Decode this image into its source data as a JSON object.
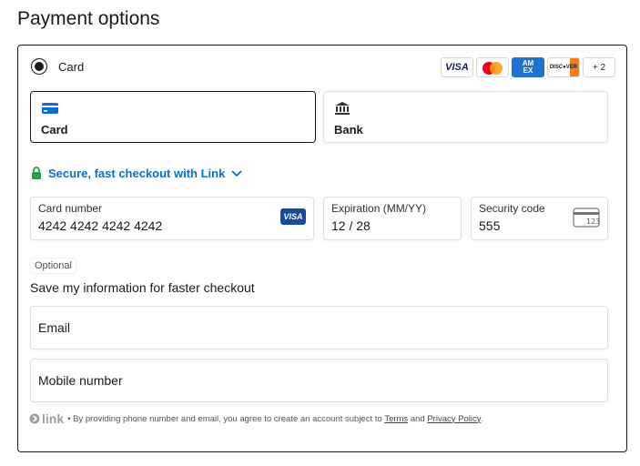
{
  "page": {
    "title": "Payment options"
  },
  "card_option": {
    "label": "Card",
    "brands": {
      "visa": "VISA",
      "amex_top": "AM",
      "amex_bottom": "EX",
      "discover": "DISC●VER",
      "more": "+ 2"
    }
  },
  "methods": [
    {
      "label": "Card",
      "icon": "credit-card-icon",
      "selected": true
    },
    {
      "label": "Bank",
      "icon": "bank-icon",
      "selected": false
    }
  ],
  "link_checkout": {
    "label": "Secure, fast checkout with Link",
    "icon": "lock-icon"
  },
  "card_fields": {
    "number_label": "Card number",
    "number_value": "4242 4242 4242 4242",
    "number_brand": "VISA",
    "expiry_label": "Expiration (MM/YY)",
    "expiry_value": "12 / 28",
    "cvc_label": "Security code",
    "cvc_value": "555",
    "cvc_icon_text": "123"
  },
  "save_info": {
    "optional_tag": "Optional",
    "heading": "Save my information for faster checkout",
    "email_label": "Email",
    "phone_label": "Mobile number"
  },
  "legal": {
    "logo_word": "link",
    "text_before": "• By providing phone number and email, you agree to create an account subject to",
    "terms": "Terms",
    "and": "and",
    "privacy": "Privacy Policy",
    "period": "."
  },
  "colors": {
    "accent": "#0a6ed1",
    "lock_green": "#1ea34a",
    "card_icon_blue": "#0a6ed1"
  }
}
